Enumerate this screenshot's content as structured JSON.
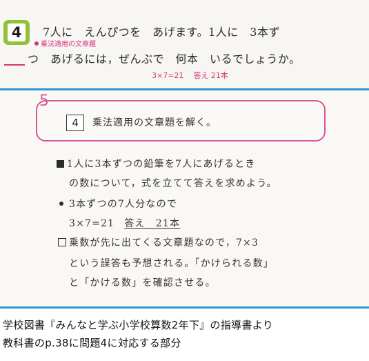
{
  "textbook": {
    "number": "4",
    "line1": "7人に　えんぴつを　あげます。1人に　3本ず",
    "tag": "乗法適用の文章題",
    "line2": "つ　あげるには，ぜんぶで　何本　いるでしょうか。",
    "equation": "3×7=21",
    "answer": "答え 21本"
  },
  "guide": {
    "label": "5",
    "number": "4",
    "title": "乗法適用の文章題を解く。",
    "item1_line1": "1人に3本ずつの鉛筆を7人にあげるとき",
    "item1_line2": "の数について，式を立てて答えを求めよう。",
    "item2_line1": "3本ずつの7人分なので",
    "item2_equation": "3×7=21",
    "item2_answer": "答え　21本",
    "item3_line1": "乗数が先に出てくる文章題なので，7×3",
    "item3_line2": "という誤答も予想される。「かけられる数」",
    "item3_line3": "と「かける数」を確認させる。"
  },
  "caption": {
    "line1": "学校図書『みんなと学ぶ小学校算数2年下』の指導書より",
    "line2": "教科書のp.38に問題4に対応する部分"
  },
  "colors": {
    "badge_green": "#8fc23a",
    "accent_pink": "#d8347a",
    "rule_blue": "#2d96cf"
  }
}
